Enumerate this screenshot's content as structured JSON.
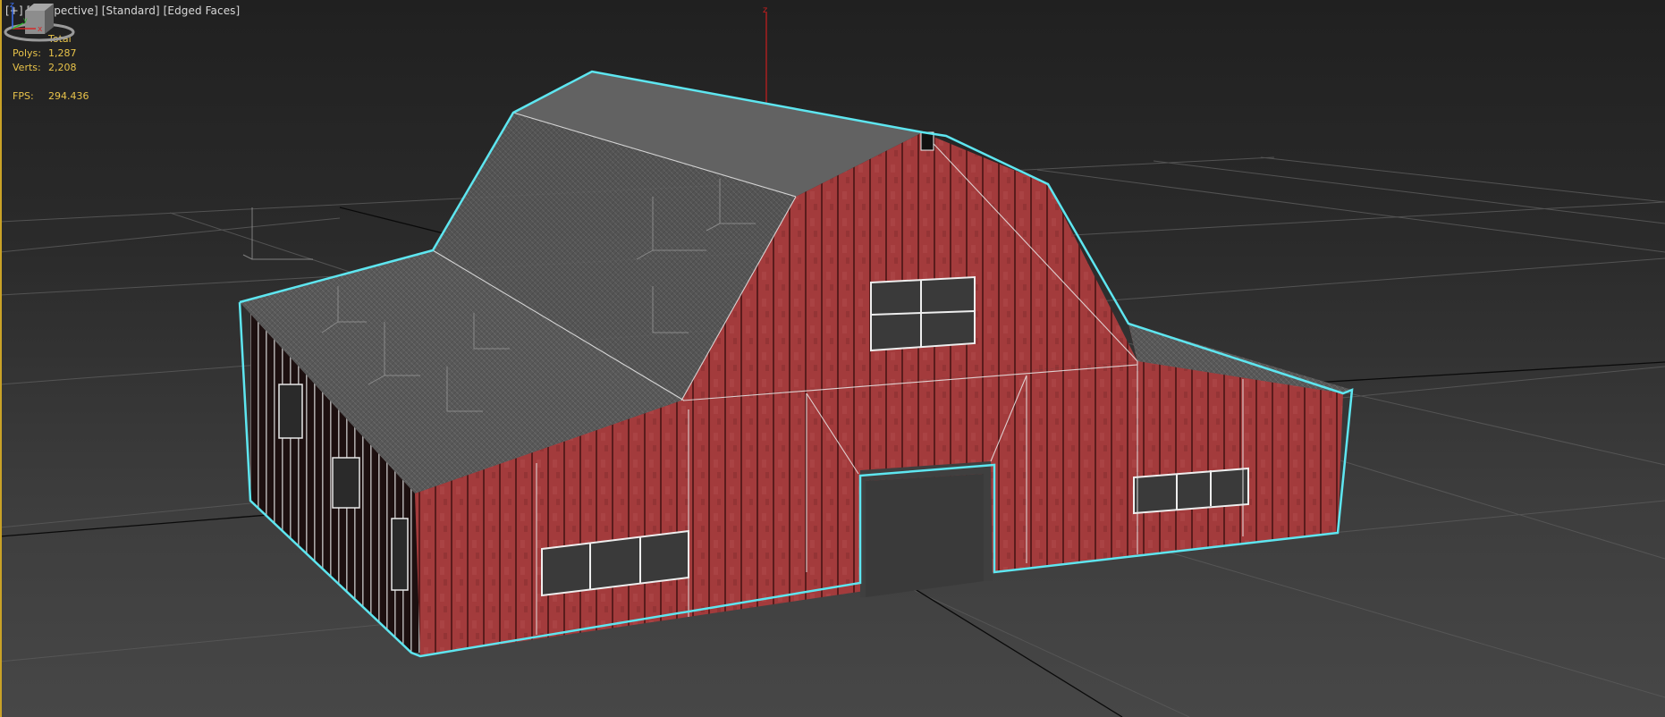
{
  "viewport": {
    "labels": [
      "[+]",
      "[Perspective]",
      "[Standard]",
      "[Edged Faces]"
    ]
  },
  "stats": {
    "header": "Total",
    "polys_label": "Polys:",
    "polys_value": "1,287",
    "verts_label": "Verts:",
    "verts_value": "2,208",
    "fps_label": "FPS:",
    "fps_value": "294.436"
  },
  "gizmo": {
    "z_label": "z"
  },
  "tripod": {
    "x_label": "x",
    "y_label": "y",
    "z_label": "z"
  },
  "colors": {
    "selection": "#5ee6f0",
    "barn_red": "#a23a3b",
    "roof": "#5b5b5b",
    "stats_text": "#e8c34a",
    "border": "#c9a227"
  }
}
